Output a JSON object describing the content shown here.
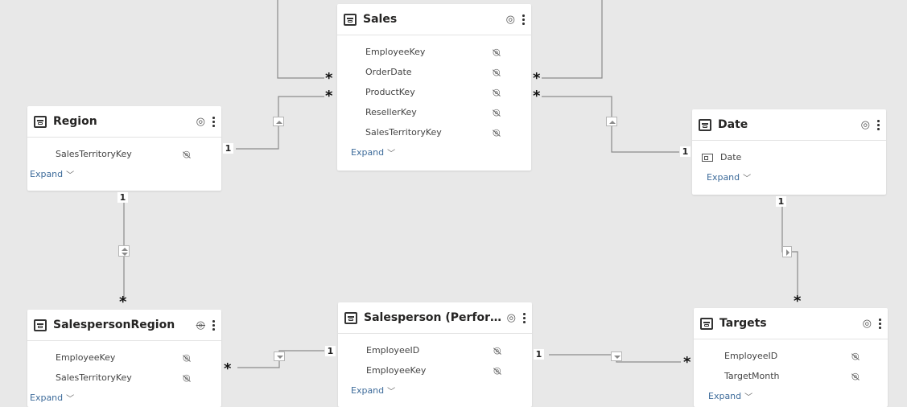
{
  "tables": {
    "sales": {
      "name": "Sales",
      "fields": [
        "EmployeeKey",
        "OrderDate",
        "ProductKey",
        "ResellerKey",
        "SalesTerritoryKey"
      ],
      "expand": "Expand"
    },
    "region": {
      "name": "Region",
      "fields": [
        "SalesTerritoryKey"
      ],
      "expand": "Expand"
    },
    "date": {
      "name": "Date",
      "fields": [
        "Date"
      ],
      "expand": "Expand"
    },
    "salespersonRegion": {
      "name": "SalespersonRegion",
      "fields": [
        "EmployeeKey",
        "SalesTerritoryKey"
      ],
      "expand": "Expand"
    },
    "salesperson": {
      "name": "Salesperson (Perform...",
      "fields": [
        "EmployeeID",
        "EmployeeKey"
      ],
      "expand": "Expand"
    },
    "targets": {
      "name": "Targets",
      "fields": [
        "EmployeeID",
        "TargetMonth"
      ],
      "expand": "Expand"
    }
  },
  "cardinality": {
    "one": "1",
    "many": "*"
  },
  "icons": {
    "table": "table-icon",
    "visible": "eye-icon",
    "hidden": "eye-hidden-icon",
    "more": "more-options-icon",
    "calendar": "calendar-icon",
    "expand": "chevron-down-icon",
    "single-direction": "filter-direction-icon",
    "both-directions": "bidirectional-filter-icon"
  },
  "colors": {
    "canvas": "#e8e8e8",
    "card": "#ffffff",
    "line": "#8a8a8a",
    "link": "#3d6b9a"
  }
}
